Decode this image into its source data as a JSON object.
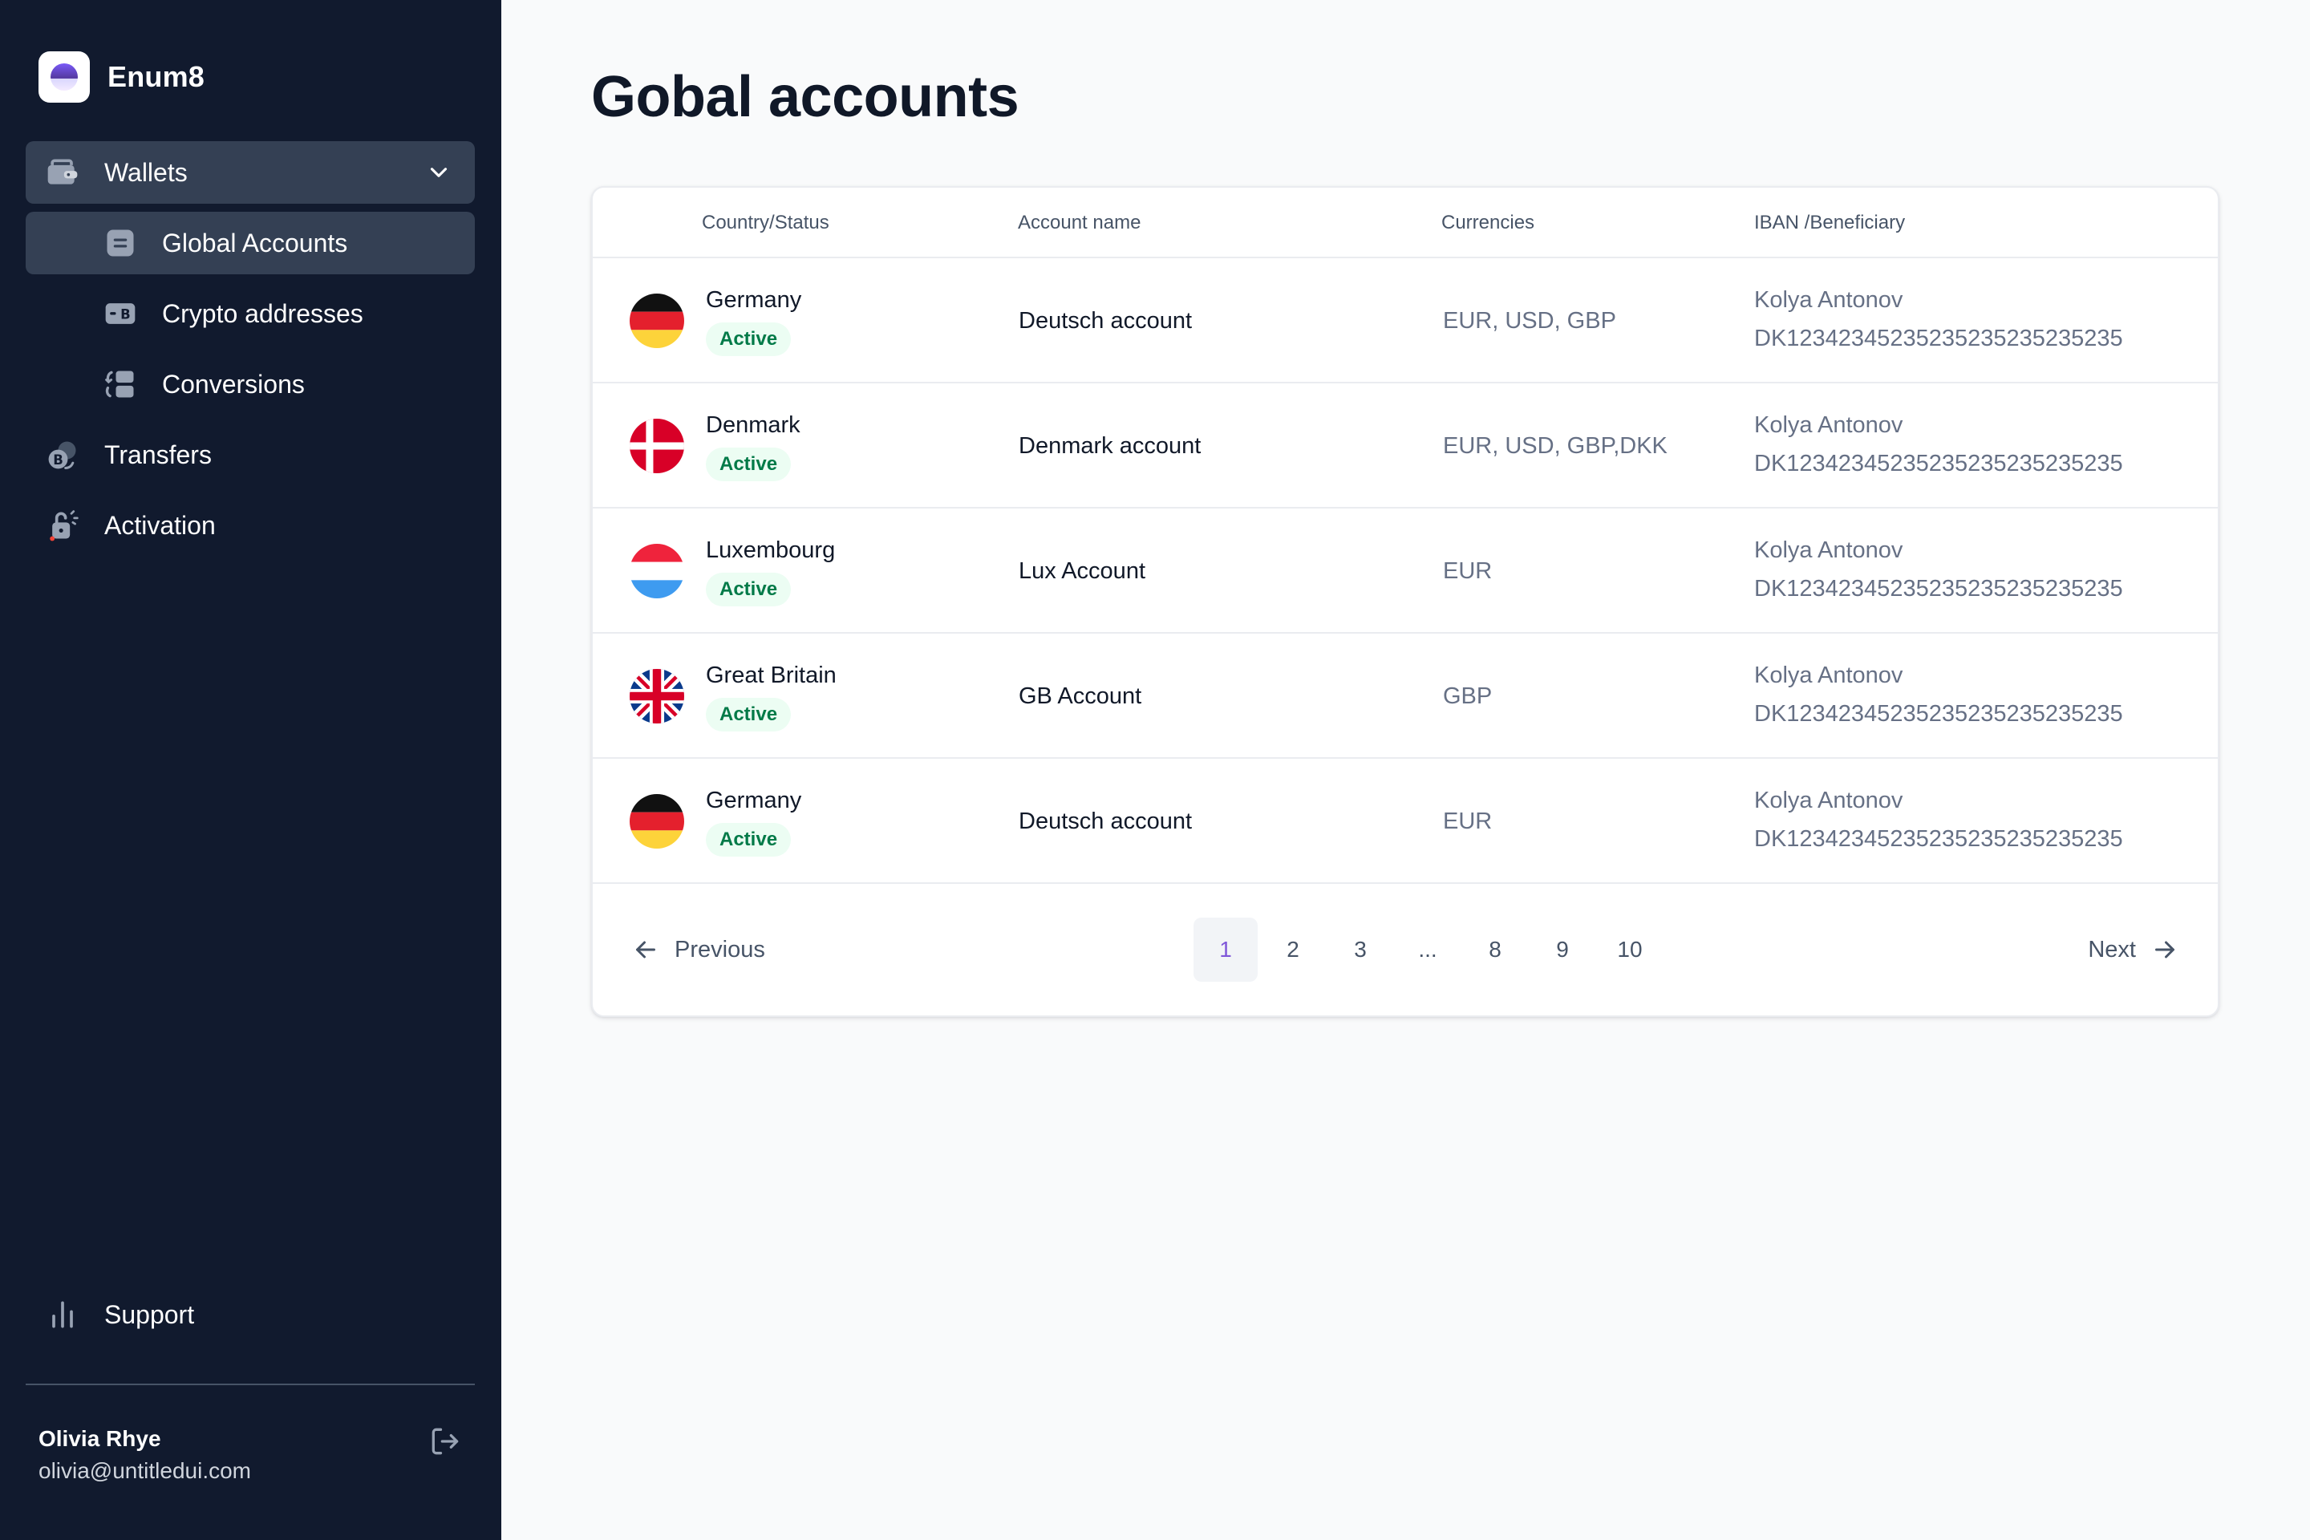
{
  "app": {
    "name": "Enum8"
  },
  "sidebar": {
    "wallets_label": "Wallets",
    "sub_items": [
      {
        "label": "Global Accounts",
        "active": true
      },
      {
        "label": "Crypto addresses",
        "active": false
      },
      {
        "label": "Conversions",
        "active": false
      }
    ],
    "transfers_label": "Transfers",
    "activation_label": "Activation",
    "support_label": "Support",
    "user": {
      "name": "Olivia Rhye",
      "email": "olivia@untitledui.com"
    }
  },
  "page": {
    "title": "Gobal accounts"
  },
  "table": {
    "headers": [
      "Country/Status",
      "Account name",
      "Currencies",
      "IBAN /Beneficiary"
    ],
    "rows": [
      {
        "flag": "germany-flag-icon",
        "country": "Germany",
        "status": "Active",
        "account": "Deutsch account",
        "currencies": "EUR, USD, GBP",
        "beneficiary": "Kolya Antonov",
        "iban": "DK12342345235235235235235235"
      },
      {
        "flag": "denmark-flag-icon",
        "country": "Denmark",
        "status": "Active",
        "account": "Denmark account",
        "currencies": "EUR, USD, GBP,DKK",
        "beneficiary": "Kolya Antonov",
        "iban": "DK12342345235235235235235235"
      },
      {
        "flag": "luxembourg-flag-icon",
        "country": "Luxembourg",
        "status": "Active",
        "account": "Lux Account",
        "currencies": "EUR",
        "beneficiary": "Kolya Antonov",
        "iban": "DK12342345235235235235235235"
      },
      {
        "flag": "great-britain-flag-icon",
        "country": "Great Britain",
        "status": "Active",
        "account": "GB Account",
        "currencies": "GBP",
        "beneficiary": "Kolya Antonov",
        "iban": "DK12342345235235235235235235"
      },
      {
        "flag": "germany-flag-icon",
        "country": "Germany",
        "status": "Active",
        "account": "Deutsch account",
        "currencies": "EUR",
        "beneficiary": "Kolya Antonov",
        "iban": "DK12342345235235235235235235"
      }
    ]
  },
  "pagination": {
    "previous_label": "Previous",
    "next_label": "Next",
    "pages": [
      "1",
      "2",
      "3",
      "...",
      "8",
      "9",
      "10"
    ],
    "current": "1"
  },
  "colors": {
    "sidebar_bg": "#111a2e",
    "nav_active_bg": "#344054",
    "badge_bg": "#ecfdf3",
    "badge_text": "#027a48",
    "accent": "#7f56d9"
  }
}
